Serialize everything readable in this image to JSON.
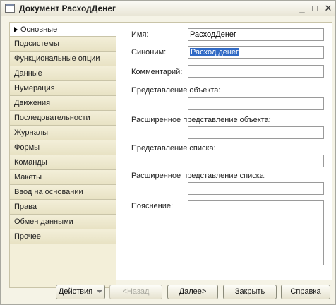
{
  "window": {
    "title": "Документ РасходДенег",
    "controls": {
      "minimize": "_",
      "maximize": "□",
      "close": "✕"
    }
  },
  "sidebar": {
    "items": [
      {
        "label": "Основные",
        "active": true
      },
      {
        "label": "Подсистемы"
      },
      {
        "label": "Функциональные опции"
      },
      {
        "label": "Данные"
      },
      {
        "label": "Нумерация"
      },
      {
        "label": "Движения"
      },
      {
        "label": "Последовательности"
      },
      {
        "label": "Журналы"
      },
      {
        "label": "Формы"
      },
      {
        "label": "Команды"
      },
      {
        "label": "Макеты"
      },
      {
        "label": "Ввод на основании"
      },
      {
        "label": "Права"
      },
      {
        "label": "Обмен данными"
      },
      {
        "label": "Прочее"
      }
    ]
  },
  "form": {
    "name_label": "Имя:",
    "name_value": "РасходДенег",
    "synonym_label": "Синоним:",
    "synonym_value": "Расход денег",
    "comment_label": "Комментарий:",
    "comment_value": "",
    "object_repr_label": "Представление объекта:",
    "object_repr_value": "",
    "ext_object_repr_label": "Расширенное представление объекта:",
    "ext_object_repr_value": "",
    "list_repr_label": "Представление списка:",
    "list_repr_value": "",
    "ext_list_repr_label": "Расширенное представление списка:",
    "ext_list_repr_value": "",
    "explanation_label": "Пояснение:"
  },
  "footer": {
    "actions": "Действия",
    "back": "<Назад",
    "next": "Далее>",
    "close": "Закрыть",
    "help": "Справка"
  }
}
